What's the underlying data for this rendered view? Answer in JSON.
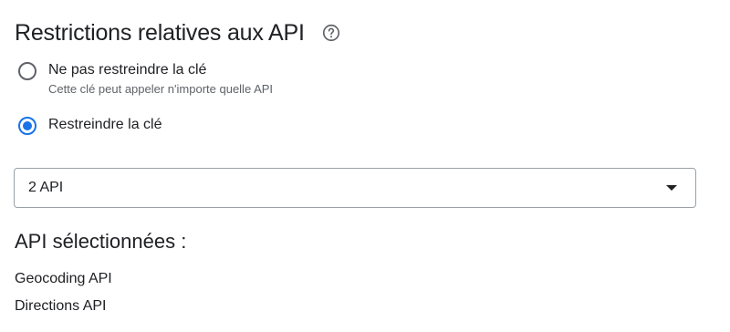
{
  "section": {
    "title": "Restrictions relatives aux API",
    "help_icon": "help-circle-icon"
  },
  "options": [
    {
      "label": "Ne pas restreindre la clé",
      "description": "Cette clé peut appeler n'importe quelle API",
      "selected": false
    },
    {
      "label": "Restreindre la clé",
      "description": "",
      "selected": true
    }
  ],
  "api_select": {
    "value": "2 API",
    "arrow_icon": "arrow-drop-down-icon"
  },
  "selected_apis": {
    "title": "API sélectionnées :",
    "items": [
      "Geocoding API",
      "Directions API"
    ]
  },
  "colors": {
    "accent": "#1a73e8",
    "text": "#202124",
    "secondary_text": "#5f6368",
    "border": "#9aa0a6"
  }
}
